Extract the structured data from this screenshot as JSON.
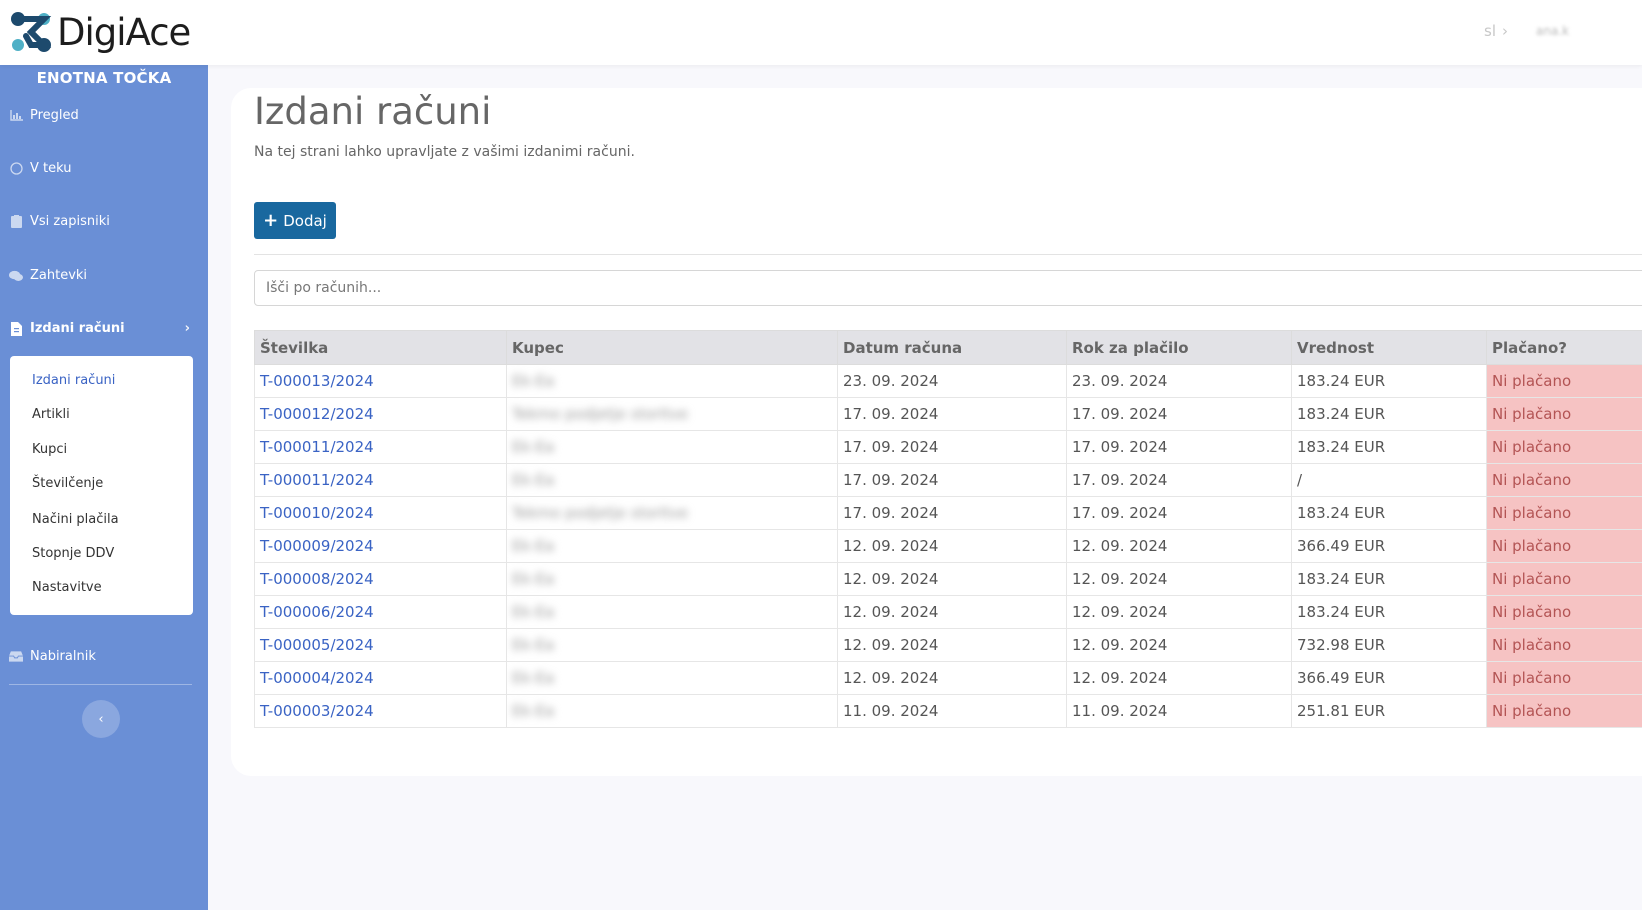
{
  "header": {
    "app_name": "DigiAce",
    "language": "sl",
    "user": "ana.k"
  },
  "sidebar": {
    "title": "ENOTNA TOČKA",
    "items": [
      {
        "label": "Pregled",
        "icon": "chart-icon"
      },
      {
        "label": "V teku",
        "icon": "circle-icon"
      },
      {
        "label": "Vsi zapisniki",
        "icon": "clipboard-icon"
      },
      {
        "label": "Zahtevki",
        "icon": "chat-icon"
      },
      {
        "label": "Izdani računi",
        "icon": "invoice-icon"
      },
      {
        "label": "Nabiralnik",
        "icon": "inbox-icon"
      }
    ],
    "submenu": [
      "Izdani računi",
      "Artikli",
      "Kupci",
      "Številčenje",
      "Načini plačila",
      "Stopnje DDV",
      "Nastavitve"
    ]
  },
  "main": {
    "title": "Izdani računi",
    "subtitle": "Na tej strani lahko upravljate z vašimi izdanimi računi.",
    "add_label": "Dodaj",
    "search_placeholder": "Išči po računih..."
  },
  "table": {
    "headers": [
      "Številka",
      "Kupec",
      "Datum računa",
      "Rok za plačilo",
      "Vrednost",
      "Plačano?"
    ],
    "rows": [
      {
        "number": "T-000013/2024",
        "customer": "Ek-Ea",
        "date": "23. 09. 2024",
        "due": "23. 09. 2024",
        "value": "183.24 EUR",
        "paid": "Ni plačano"
      },
      {
        "number": "T-000012/2024",
        "customer": "Tekmo podjetje storitve",
        "date": "17. 09. 2024",
        "due": "17. 09. 2024",
        "value": "183.24 EUR",
        "paid": "Ni plačano"
      },
      {
        "number": "T-000011/2024",
        "customer": "Ek-Ea",
        "date": "17. 09. 2024",
        "due": "17. 09. 2024",
        "value": "183.24 EUR",
        "paid": "Ni plačano"
      },
      {
        "number": "T-000011/2024",
        "customer": "Ek-Ea",
        "date": "17. 09. 2024",
        "due": "17. 09. 2024",
        "value": "/",
        "paid": "Ni plačano"
      },
      {
        "number": "T-000010/2024",
        "customer": "Tekmo podjetje storitve",
        "date": "17. 09. 2024",
        "due": "17. 09. 2024",
        "value": "183.24 EUR",
        "paid": "Ni plačano"
      },
      {
        "number": "T-000009/2024",
        "customer": "Ek-Ea",
        "date": "12. 09. 2024",
        "due": "12. 09. 2024",
        "value": "366.49 EUR",
        "paid": "Ni plačano"
      },
      {
        "number": "T-000008/2024",
        "customer": "Ek-Ea",
        "date": "12. 09. 2024",
        "due": "12. 09. 2024",
        "value": "183.24 EUR",
        "paid": "Ni plačano"
      },
      {
        "number": "T-000006/2024",
        "customer": "Ek-Ea",
        "date": "12. 09. 2024",
        "due": "12. 09. 2024",
        "value": "183.24 EUR",
        "paid": "Ni plačano"
      },
      {
        "number": "T-000005/2024",
        "customer": "Ek-Ea",
        "date": "12. 09. 2024",
        "due": "12. 09. 2024",
        "value": "732.98 EUR",
        "paid": "Ni plačano"
      },
      {
        "number": "T-000004/2024",
        "customer": "Ek-Ea",
        "date": "12. 09. 2024",
        "due": "12. 09. 2024",
        "value": "366.49 EUR",
        "paid": "Ni plačano"
      },
      {
        "number": "T-000003/2024",
        "customer": "Ek-Ea",
        "date": "11. 09. 2024",
        "due": "11. 09. 2024",
        "value": "251.81 EUR",
        "paid": "Ni plačano"
      }
    ]
  },
  "colors": {
    "sidebar_bg": "#6a8fd6",
    "accent": "#19689f",
    "link": "#3a63c4",
    "unpaid_bg": "#f6c3c3"
  }
}
